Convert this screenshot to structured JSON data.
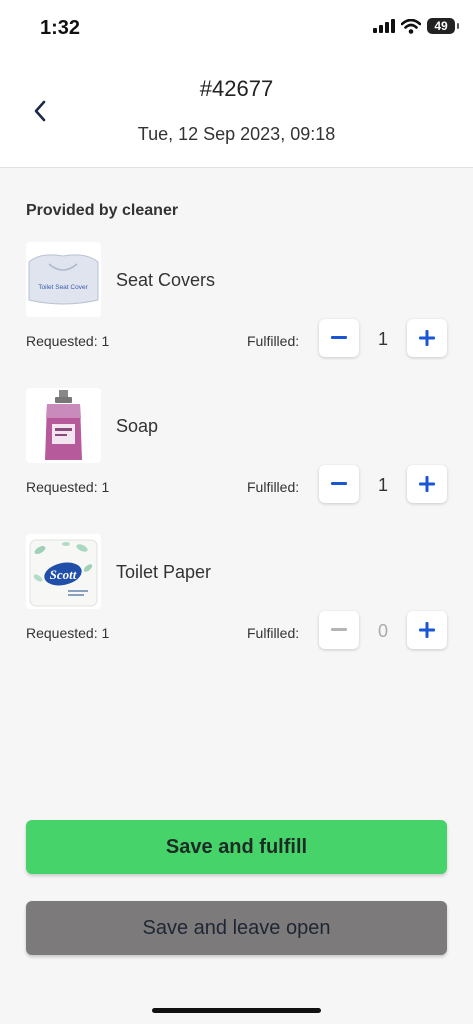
{
  "status_bar": {
    "time": "1:32",
    "battery": "49"
  },
  "header": {
    "order_id": "#42677",
    "date": "Tue, 12 Sep 2023, 09:18",
    "back_icon": "chevron-left-icon"
  },
  "section": {
    "title": "Provided by cleaner"
  },
  "items": [
    {
      "name": "Seat Covers",
      "requested": "Requested: 1",
      "fulfilled_label": "Fulfilled:",
      "fulfilled_value": "1",
      "image_text": "Toilet Seat Cover"
    },
    {
      "name": "Soap",
      "requested": "Requested: 1",
      "fulfilled_label": "Fulfilled:",
      "fulfilled_value": "1"
    },
    {
      "name": "Toilet Paper",
      "requested": "Requested: 1",
      "fulfilled_label": "Fulfilled:",
      "fulfilled_value": "0",
      "image_text": "Scott"
    }
  ],
  "actions": {
    "primary": "Save and fulfill",
    "secondary": "Save and leave open"
  },
  "colors": {
    "accent_blue": "#1a55d6",
    "primary_green": "#45d36a",
    "secondary_gray": "#7c7a7a",
    "disabled_gray": "#aaaaaa"
  }
}
